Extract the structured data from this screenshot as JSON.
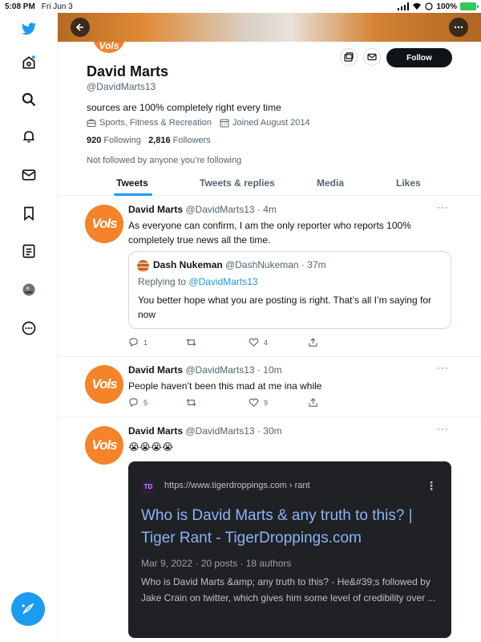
{
  "status_bar": {
    "time": "5:08 PM",
    "date": "Fri Jun 3",
    "battery": "100%"
  },
  "profile": {
    "name": "David Marts",
    "handle": "@DavidMarts13",
    "bio": "sources are 100% completely right every time",
    "category": "Sports, Fitness & Recreation",
    "joined": "Joined August 2014",
    "following_count": "920",
    "following_label": "Following",
    "followers_count": "2,816",
    "followers_label": "Followers",
    "follow_note": "Not followed by anyone you’re following",
    "follow_button": "Follow",
    "avatar_text": "Vols"
  },
  "tabs": [
    "Tweets",
    "Tweets & replies",
    "Media",
    "Likes"
  ],
  "tweets": [
    {
      "name": "David Marts",
      "handle": "@DavidMarts13",
      "time": "· 4m",
      "text": "As everyone can confirm, I am the only reporter who reports 100% completely true news all the time.",
      "quote": {
        "name": "Dash Nukeman",
        "handle": "@DashNukeman",
        "time": "· 37m",
        "replying_label": "Replying to",
        "replying_to": "@DavidMarts13",
        "text": "You better hope what you are posting is right. That’s all I’m saying for now"
      },
      "replies": "1",
      "retweets": "",
      "likes": "4"
    },
    {
      "name": "David Marts",
      "handle": "@DavidMarts13",
      "time": "· 10m",
      "text": "People haven’t been this mad at me ina while",
      "replies": "5",
      "retweets": "",
      "likes": "9"
    },
    {
      "name": "David Marts",
      "handle": "@DavidMarts13",
      "time": "· 30m",
      "text": "😭😭😭😭",
      "card": {
        "logo": "TD",
        "url": "https://www.tigerdroppings.com › rant",
        "title": "Who is David Marts & any truth to this? | Tiger Rant - TigerDroppings.com",
        "meta": "Mar 9, 2022 · 20 posts · 18 authors",
        "description": "Who is David Marts &amp; any truth to this? - He&#39;s followed by Jake Crain on twitter, which gives him some level of credibility over ..."
      }
    }
  ],
  "colors": {
    "accent": "#1d9bf0",
    "avatar_orange": "#f4832a",
    "text": "#0f1419",
    "muted": "#536471"
  }
}
